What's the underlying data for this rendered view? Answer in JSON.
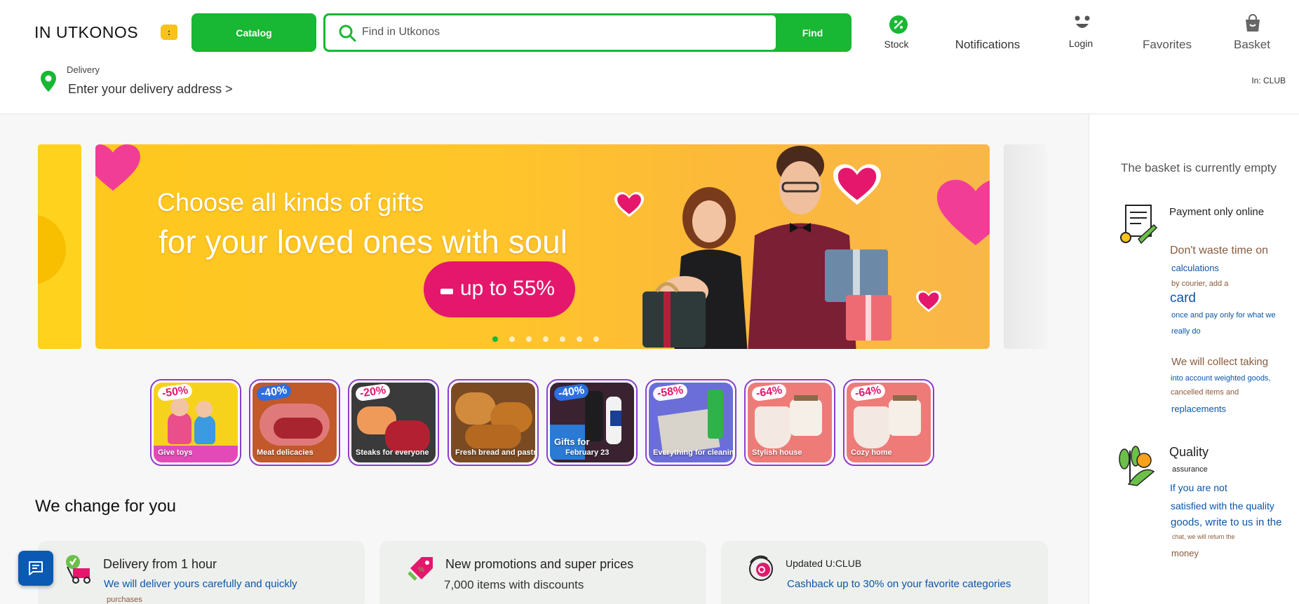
{
  "header": {
    "logo": "IN UTKONOS",
    "logo_badge": ":",
    "catalog_label": "Catalog",
    "search_placeholder": "Find in Utkonos",
    "find_label": "Find",
    "nav": {
      "stock": "Stock",
      "notifications": "Notifications",
      "login": "Login",
      "favorites": "Favorites",
      "basket": "Basket"
    },
    "delivery_label": "Delivery",
    "delivery_address": "Enter your delivery address >",
    "club": "In: CLUB"
  },
  "banner": {
    "line1": "Choose all kinds of gifts",
    "line2": "for your loved ones with soul",
    "promo": "up to 55%",
    "slides": 7,
    "active_slide": 1
  },
  "tiles": [
    {
      "badge": "-50%",
      "label": "Give toys",
      "bg": "#f7d21c"
    },
    {
      "badge": "-40%",
      "label": "Meat delicacies",
      "bg": "#c1592a"
    },
    {
      "badge": "-20%",
      "label": "Steaks for everyone",
      "bg": "#3a3a3a"
    },
    {
      "badge": "",
      "label": "Fresh bread and pastries",
      "bg": "#7a4a22"
    },
    {
      "badge": "-40%",
      "label": "Gifts for",
      "label2": "February 23",
      "bg": "#3a2230"
    },
    {
      "badge": "-58%",
      "label": "Everything for cleaning",
      "bg": "#6b6ed8"
    },
    {
      "badge": "-64%",
      "label": "Stylish house",
      "bg": "#ee7b78"
    },
    {
      "badge": "-64%",
      "label": "Cozy home",
      "bg": "#ee7b78"
    }
  ],
  "section": {
    "title": "We change for you",
    "cards": [
      {
        "title": "Delivery from 1 hour",
        "sub": "We will deliver yours carefully and quickly",
        "sub2": "purchases",
        "sub_color": "#0a56a8"
      },
      {
        "title": "New promotions and super prices",
        "sub": "7,000 items with discounts",
        "sub_color": "#333"
      },
      {
        "title": "Updated U:CLUB",
        "sub": "Cashback up to 30% on your favorite categories",
        "sub_color": "#0a56a8"
      }
    ]
  },
  "right_panel": {
    "empty": "The basket is currently empty",
    "b1_title": "Payment only online",
    "b1_l1": "Don't waste time on",
    "b1_l2": "calculations",
    "b1_l3": "by courier, add a",
    "b1_l4": "card",
    "b1_l5": "once and pay only for what we",
    "b1_l6": "really do",
    "b2_l1": "We will collect taking",
    "b2_l2": "into account weighted goods,",
    "b2_l3": "cancelled items and",
    "b2_l4": "replacements",
    "b3_title": "Quality",
    "b3_l1": "assurance",
    "b3_l2": "If you are not",
    "b3_l3": "satisfied with the quality",
    "b3_l4": "goods, write to us in the",
    "b3_l5": "chat, we will return the",
    "b3_l6": "money"
  },
  "colors": {
    "brand_green": "#18b734",
    "promo_pink": "#e4176d",
    "tile_border": "#8b3ccf",
    "link_blue": "#0a56a8",
    "brown_text": "#8a5a3c"
  },
  "icons": [
    "search-icon",
    "percent-icon",
    "face-icon",
    "bag-icon",
    "location-pin-icon",
    "chat-icon",
    "receipt-icon",
    "plant-icon"
  ]
}
